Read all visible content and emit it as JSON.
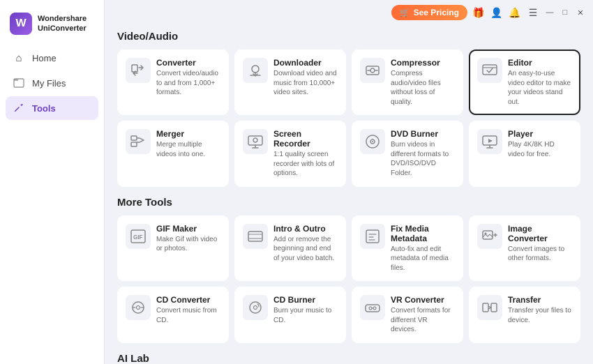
{
  "app": {
    "logo_text_line1": "Wondershare",
    "logo_text_line2": "UniConverter"
  },
  "topbar": {
    "see_pricing_label": "See Pricing",
    "cart_icon": "🛒",
    "gift_icon": "🎁",
    "user_icon": "👤",
    "bell_icon": "🔔",
    "menu_icon": "☰",
    "minimize_icon": "—",
    "maximize_icon": "□",
    "close_icon": "✕"
  },
  "sidebar": {
    "items": [
      {
        "id": "home",
        "label": "Home",
        "icon": "⌂"
      },
      {
        "id": "my-files",
        "label": "My Files",
        "icon": "📁"
      },
      {
        "id": "tools",
        "label": "Tools",
        "icon": "🔧"
      }
    ]
  },
  "sections": [
    {
      "id": "video-audio",
      "title": "Video/Audio",
      "tools": [
        {
          "id": "converter",
          "name": "Converter",
          "desc": "Convert video/audio to and from 1,000+ formats.",
          "icon": "converter",
          "selected": false
        },
        {
          "id": "downloader",
          "name": "Downloader",
          "desc": "Download video and music from 10,000+ video sites.",
          "icon": "downloader",
          "selected": false
        },
        {
          "id": "compressor",
          "name": "Compressor",
          "desc": "Compress audio/video files without loss of quality.",
          "icon": "compressor",
          "selected": false
        },
        {
          "id": "editor",
          "name": "Editor",
          "desc": "An easy-to-use video editor to make your videos stand out.",
          "icon": "editor",
          "selected": true
        },
        {
          "id": "merger",
          "name": "Merger",
          "desc": "Merge multiple videos into one.",
          "icon": "merger",
          "selected": false
        },
        {
          "id": "screen-recorder",
          "name": "Screen Recorder",
          "desc": "1:1 quality screen recorder with lots of options.",
          "icon": "screen-recorder",
          "selected": false
        },
        {
          "id": "dvd-burner",
          "name": "DVD Burner",
          "desc": "Burn videos in different formats to DVD/ISO/DVD Folder.",
          "icon": "dvd-burner",
          "selected": false
        },
        {
          "id": "player",
          "name": "Player",
          "desc": "Play 4K/8K HD video for free.",
          "icon": "player",
          "selected": false
        }
      ]
    },
    {
      "id": "more-tools",
      "title": "More Tools",
      "tools": [
        {
          "id": "gif-maker",
          "name": "GIF Maker",
          "desc": "Make Gif with video or photos.",
          "icon": "gif-maker",
          "selected": false
        },
        {
          "id": "intro-outro",
          "name": "Intro & Outro",
          "desc": "Add or remove the beginning and end of your video batch.",
          "icon": "intro-outro",
          "selected": false
        },
        {
          "id": "fix-media-metadata",
          "name": "Fix Media Metadata",
          "desc": "Auto-fix and edit metadata of media files.",
          "icon": "fix-media-metadata",
          "selected": false
        },
        {
          "id": "image-converter",
          "name": "Image Converter",
          "desc": "Convert images to other formats.",
          "icon": "image-converter",
          "selected": false
        },
        {
          "id": "cd-converter",
          "name": "CD Converter",
          "desc": "Convert music from CD.",
          "icon": "cd-converter",
          "selected": false
        },
        {
          "id": "cd-burner",
          "name": "CD Burner",
          "desc": "Burn your music to CD.",
          "icon": "cd-burner",
          "selected": false
        },
        {
          "id": "vr-converter",
          "name": "VR Converter",
          "desc": "Convert formats for different VR devices.",
          "icon": "vr-converter",
          "selected": false
        },
        {
          "id": "transfer",
          "name": "Transfer",
          "desc": "Transfer your files to device.",
          "icon": "transfer",
          "selected": false
        }
      ]
    },
    {
      "id": "ai-lab",
      "title": "AI Lab",
      "tools": []
    }
  ]
}
